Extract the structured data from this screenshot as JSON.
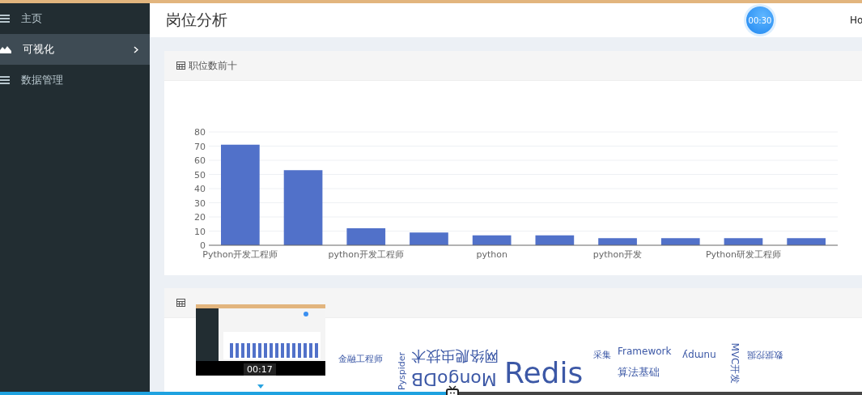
{
  "sidebar": {
    "items": [
      {
        "label": "主页",
        "kind": "link",
        "selected": false
      },
      {
        "label": "可视化",
        "kind": "group",
        "selected": true
      },
      {
        "label": "数据管理",
        "kind": "link",
        "selected": false
      }
    ]
  },
  "header": {
    "title": "岗位分析",
    "timer": "00:30",
    "user": "Ho"
  },
  "cards": [
    {
      "title": "职位数前十",
      "chart_data": {
        "type": "bar",
        "grid": true,
        "categories": [
          "Python开发工程师",
          null,
          "python开发工程师",
          null,
          "python",
          null,
          "python开发",
          null,
          "Python研发工程师",
          null
        ],
        "values": [
          71,
          53,
          12,
          9,
          7,
          7,
          5,
          5,
          5,
          5
        ],
        "ylim": [
          0,
          80
        ],
        "yticks": [
          0,
          10,
          20,
          30,
          40,
          50,
          60,
          70,
          80
        ]
      }
    },
    {
      "words": [
        "金融工程师",
        "Pyspider",
        "网络爬虫技术",
        "MongoDB",
        "Redis",
        "采集",
        "Framework",
        "算法基础",
        "numpy",
        "MVC开发",
        "数据挖掘"
      ]
    }
  ],
  "player": {
    "preview_time": "00:17",
    "progress": {
      "level": 0.525
    }
  }
}
